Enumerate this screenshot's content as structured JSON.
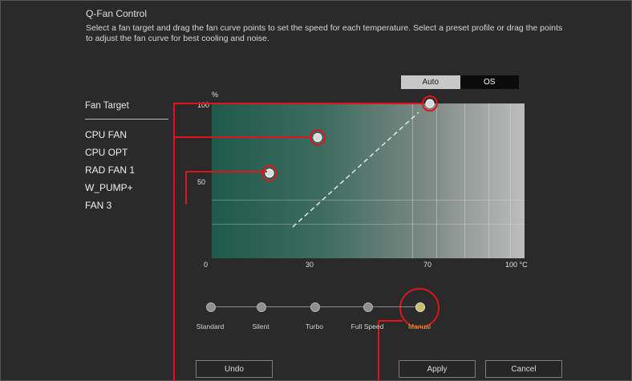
{
  "header": {
    "title": "Q-Fan Control",
    "description": "Select a fan target and drag the fan curve points to set the speed for each temperature. Select a preset profile or drag the points to adjust the fan curve for best cooling and noise."
  },
  "mode_toggle": {
    "left_label": "Auto",
    "right_label": "OS",
    "selected": "left"
  },
  "fan_target": {
    "label": "Fan Target",
    "items": [
      "CPU FAN",
      "CPU OPT",
      "RAD FAN 1",
      "W_PUMP+",
      "FAN 3"
    ]
  },
  "fan_curve": {
    "y_ticks": [
      "%",
      "100",
      "50"
    ],
    "x_ticks": [
      "0",
      "30",
      "70",
      "100 °C"
    ]
  },
  "chart_data": {
    "type": "line",
    "title": "",
    "xlabel": "",
    "ylabel": "",
    "xlim": [
      0,
      100
    ],
    "ylim": [
      0,
      100
    ],
    "series": [
      {
        "points": [
          [
            20,
            55
          ],
          [
            35,
            78
          ],
          [
            70,
            100
          ]
        ]
      }
    ]
  },
  "presets": {
    "items": [
      "Standard",
      "Silent",
      "Turbo",
      "Full Speed",
      "Manual"
    ],
    "selected_index": 4
  },
  "buttons": {
    "undo": "Undo",
    "apply": "Apply",
    "cancel": "Cancel"
  },
  "colors": {
    "highlight": "#e0151b",
    "curve_fill": "#1f5a4b",
    "active_preset": "#c9c265"
  }
}
